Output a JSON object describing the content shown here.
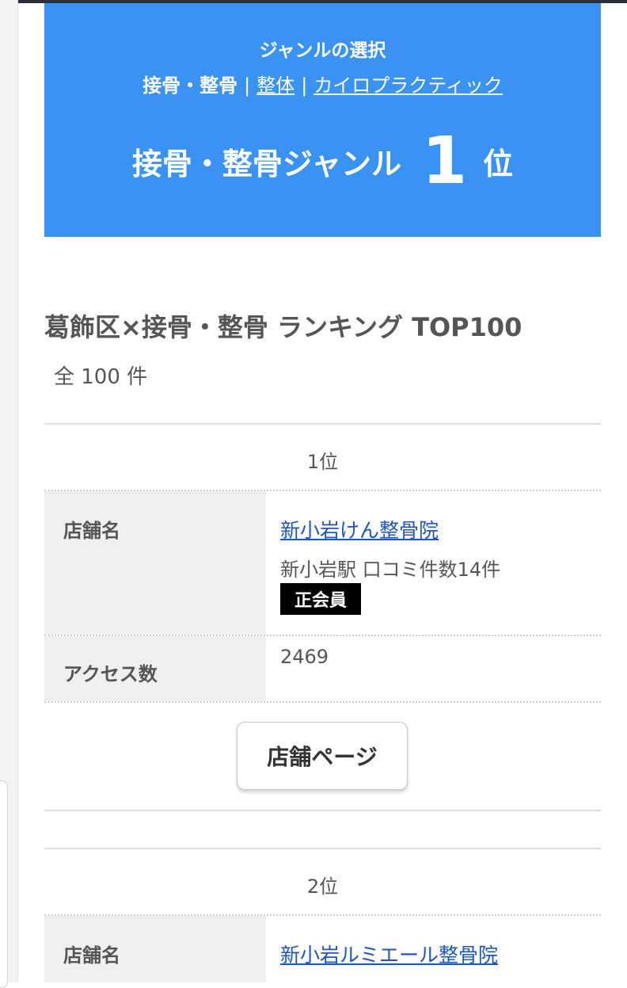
{
  "genre": {
    "title": "ジャンルの選択",
    "current": "接骨・整骨",
    "sep1": "|",
    "link_seitai": "整体",
    "sep2": "|",
    "link_chiro": "カイロプラクティック",
    "rank_label": "接骨・整骨ジャンル",
    "rank_number": "1",
    "rank_suffix": "位"
  },
  "ranking": {
    "title": "葛飾区×接骨・整骨 ランキング TOP100",
    "total": "全 100 件"
  },
  "entries": [
    {
      "rank": "1位",
      "shop_label": "店舗名",
      "shop_name": "新小岩けん整骨院",
      "shop_meta": "新小岩駅 口コミ件数14件",
      "badge": "正会員",
      "access_label": "アクセス数",
      "access_value": "2469",
      "button": "店舗ページ"
    },
    {
      "rank": "2位",
      "shop_label": "店舗名",
      "shop_name": "新小岩ルミエール整骨院"
    }
  ],
  "colors": {
    "genre_bg": "#3a92f2",
    "link": "#1f56b8",
    "badge_bg": "#000000"
  }
}
